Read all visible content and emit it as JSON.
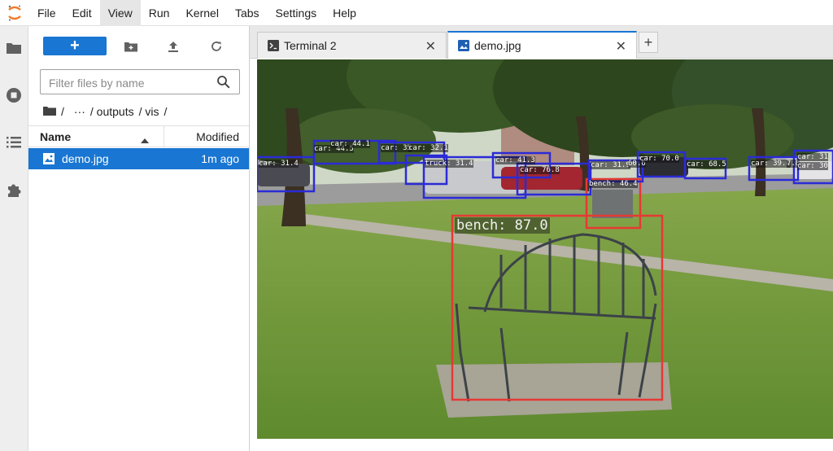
{
  "menubar": {
    "items": [
      "File",
      "Edit",
      "View",
      "Run",
      "Kernel",
      "Tabs",
      "Settings",
      "Help"
    ],
    "active_index": 2
  },
  "activity_bar": {
    "icons": [
      "folder-icon",
      "running-icon",
      "toc-icon",
      "extension-icon"
    ]
  },
  "file_browser": {
    "new_button_label": "+",
    "search_placeholder": "Filter files by name",
    "breadcrumbs": [
      "/",
      "···",
      "/ outputs",
      "/ vis",
      "/"
    ],
    "columns": {
      "name": "Name",
      "modified": "Modified"
    },
    "files": [
      {
        "name": "demo.jpg",
        "modified": "1m ago",
        "selected": true
      }
    ]
  },
  "tabs": [
    {
      "label": "Terminal 2",
      "icon": "terminal-icon",
      "active": false
    },
    {
      "label": "demo.jpg",
      "icon": "image-icon",
      "active": true
    }
  ],
  "add_tab_label": "+",
  "detections": [
    {
      "label": "bench: 87.0",
      "type": "bench"
    },
    {
      "label": "bench: 46.4",
      "type": "bench"
    },
    {
      "label": "car: 31.4",
      "type": "car"
    },
    {
      "label": "car: 44.5",
      "type": "car"
    },
    {
      "label": "car: 44.1",
      "type": "car"
    },
    {
      "label": "car: 35",
      "type": "car"
    },
    {
      "label": "car: 32.1",
      "type": "car"
    },
    {
      "label": "truck: 31.4",
      "type": "truck"
    },
    {
      "label": "car: 41.3",
      "type": "car"
    },
    {
      "label": "car: 76.8",
      "type": "car"
    },
    {
      "label": "car: 31.9",
      "type": "car"
    },
    {
      "label": "60.6",
      "type": "car"
    },
    {
      "label": "car: 70.0",
      "type": "car"
    },
    {
      "label": "car: 68.5",
      "type": "car"
    },
    {
      "label": "car: 39.4",
      "type": "car"
    },
    {
      "label": "7.8",
      "type": "car"
    },
    {
      "label": "car: 31",
      "type": "car"
    },
    {
      "label": "car: 30",
      "type": "car"
    }
  ],
  "colors": {
    "accent": "#1976d2",
    "bench_box": "#e53935",
    "car_box": "#2b2bd6"
  }
}
